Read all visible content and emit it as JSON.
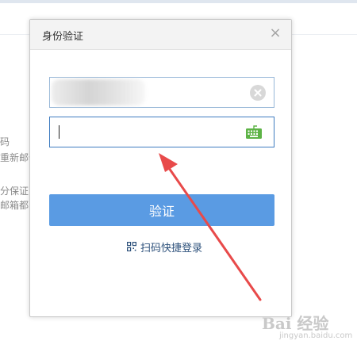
{
  "dialog": {
    "title": "身份验证",
    "close_symbol": "×",
    "username": {
      "value": "",
      "clear_icon": "clear-icon"
    },
    "password": {
      "value": "",
      "placeholder": "",
      "keyboard_icon": "keyboard-icon"
    },
    "verify_button_label": "验证",
    "qr_login_label": "扫码快捷登录",
    "qr_icon": "qr-code-icon"
  },
  "background": {
    "fragments": [
      "码",
      "重新邮件",
      "分保证",
      "邮箱都"
    ]
  },
  "watermark": {
    "main": "Bai  经验",
    "sub": "jingyan.baidu.com"
  },
  "colors": {
    "accent": "#5a9be3",
    "field_border": "#98b8d8",
    "field_focus_border": "#3f7cc0",
    "annotation_arrow": "#e84a4a",
    "keyboard_icon": "#5db346"
  }
}
